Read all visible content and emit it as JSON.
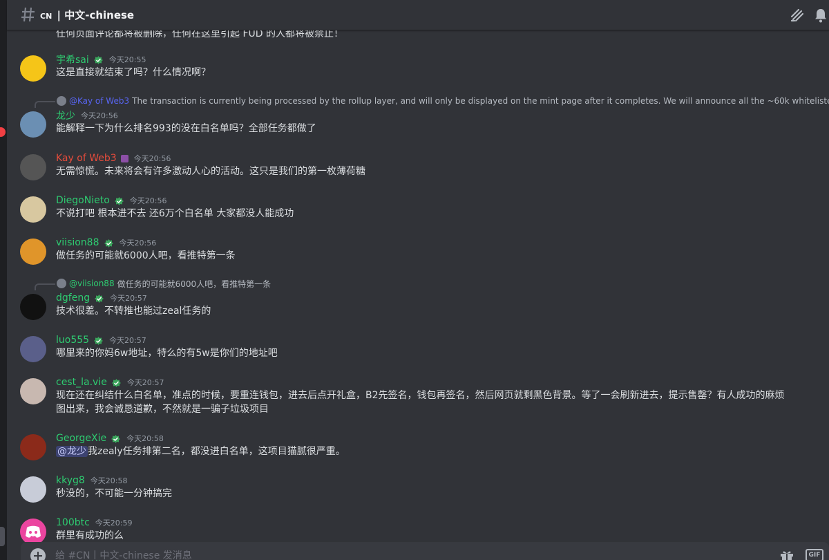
{
  "header": {
    "channel_flag": "CN",
    "channel_title": "| 中文-chinese"
  },
  "system_line": "任何页面评论都将被删除，任何在这里引起 FUD 的人都将被禁止！",
  "messages": [
    {
      "username": "宇希sai",
      "name_color": "#2ecc71",
      "timestamp": "今天20:55",
      "content": "这是直接就结束了吗？什么情况啊？",
      "avatar_color": "#f5c518"
    },
    {
      "username": "龙少",
      "name_color": "#2ecc71",
      "timestamp": "今天20:56",
      "content": "能解释一下为什么排名993的没在白名单吗？全部任务都做了",
      "avatar_color": "#6b8fb3",
      "reply": {
        "name": "@Kay of Web3",
        "text": "The transaction is currently being processed by the rollup layer, and will only be displayed on the mint page after it completes. We will announce all the ~60k whitelisted addresses ar"
      }
    },
    {
      "username": "Kay of Web3",
      "name_color": "#e74c3c",
      "timestamp": "今天20:56",
      "content": "无需惊慌。未来将会有许多激动人心的活动。这只是我们的第一枚薄荷糖",
      "avatar_color": "#555555"
    },
    {
      "username": "DiegoNieto",
      "name_color": "#2ecc71",
      "timestamp": "今天20:56",
      "content": "不说打吧 根本进不去 还6万个白名单 大家都没人能成功",
      "avatar_color": "#d8c8a0"
    },
    {
      "username": "viision88",
      "name_color": "#2ecc71",
      "timestamp": "今天20:56",
      "content": "做任务的可能就6000人吧，看推特第一条",
      "avatar_color": "#e0952a"
    },
    {
      "username": "dgfeng",
      "name_color": "#2ecc71",
      "timestamp": "今天20:57",
      "content": "技术很差。不转推也能过zeal任务的",
      "avatar_color": "#111111",
      "reply": {
        "name": "@viision88",
        "text": "做任务的可能就6000人吧，看推特第一条"
      }
    },
    {
      "username": "luo555",
      "name_color": "#2ecc71",
      "timestamp": "今天20:57",
      "content": "哪里来的你妈6w地址，特么的有5w是你们的地址吧",
      "avatar_color": "#5a5f8a"
    },
    {
      "username": "cest_la.vie",
      "name_color": "#2ecc71",
      "timestamp": "今天20:57",
      "content_line1": "现在还在纠结什么白名单，准点的时候，要重连钱包，进去后点开礼盒，B2先签名，钱包再签名，然后网页就剩黑色背景。等了一会刷新进去，提示售罄？有人成功的麻烦",
      "content_line2": "图出来，我会诚恳道歉，不然就是一骗子垃圾项目",
      "avatar_color": "#c8b8b0"
    },
    {
      "username": "GeorgeXie",
      "name_color": "#2ecc71",
      "timestamp": "今天20:58",
      "mention": "@龙少",
      "content": "我zealy任务排第二名，都没进白名单，这项目猫腻很严重。",
      "avatar_color": "#8b2a1a"
    },
    {
      "username": "kkyg8",
      "name_color": "#2ecc71",
      "timestamp": "今天20:58",
      "content": "秒没的，不可能一分钟搞完",
      "avatar_color": "#c8ccd8"
    },
    {
      "username": "100btc",
      "name_color": "#2ecc71",
      "timestamp": "今天20:59",
      "content": "群里有成功的么",
      "avatar_color": "#eb459f"
    }
  ],
  "composer": {
    "placeholder": "给 #CN丨中文-chinese 发消息",
    "gif_label": "GIF"
  },
  "icons": {
    "hash": "hashtag-icon",
    "threads": "threads-icon",
    "bell": "bell-icon",
    "plus": "add-attachment-icon",
    "gift": "gift-icon",
    "badge": "verified-badge-icon",
    "discord": "discord-logo-icon"
  }
}
